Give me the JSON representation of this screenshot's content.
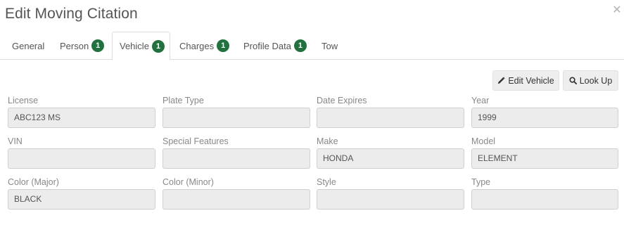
{
  "dialog": {
    "title": "Edit Moving Citation",
    "close_icon": "close-icon"
  },
  "tabs": [
    {
      "label": "General",
      "badge": null
    },
    {
      "label": "Person",
      "badge": "1"
    },
    {
      "label": "Vehicle",
      "badge": "1",
      "active": true
    },
    {
      "label": "Charges",
      "badge": "1"
    },
    {
      "label": "Profile Data",
      "badge": "1"
    },
    {
      "label": "Tow",
      "badge": null
    }
  ],
  "toolbar": {
    "edit_label": "Edit Vehicle",
    "edit_icon": "pencil-icon",
    "lookup_label": "Look Up",
    "lookup_icon": "search-icon"
  },
  "fields": {
    "license": {
      "label": "License",
      "value": "ABC123 MS"
    },
    "plate_type": {
      "label": "Plate Type",
      "value": ""
    },
    "date_expires": {
      "label": "Date Expires",
      "value": ""
    },
    "year": {
      "label": "Year",
      "value": "1999"
    },
    "vin": {
      "label": "VIN",
      "value": ""
    },
    "special_features": {
      "label": "Special Features",
      "value": ""
    },
    "make": {
      "label": "Make",
      "value": "HONDA"
    },
    "model": {
      "label": "Model",
      "value": "ELEMENT"
    },
    "color_major": {
      "label": "Color (Major)",
      "value": "BLACK"
    },
    "color_minor": {
      "label": "Color (Minor)",
      "value": ""
    },
    "style": {
      "label": "Style",
      "value": ""
    },
    "type": {
      "label": "Type",
      "value": ""
    }
  },
  "colors": {
    "badge": "#22703e",
    "field_bg": "#ececec",
    "tab_border": "#dddddd"
  }
}
